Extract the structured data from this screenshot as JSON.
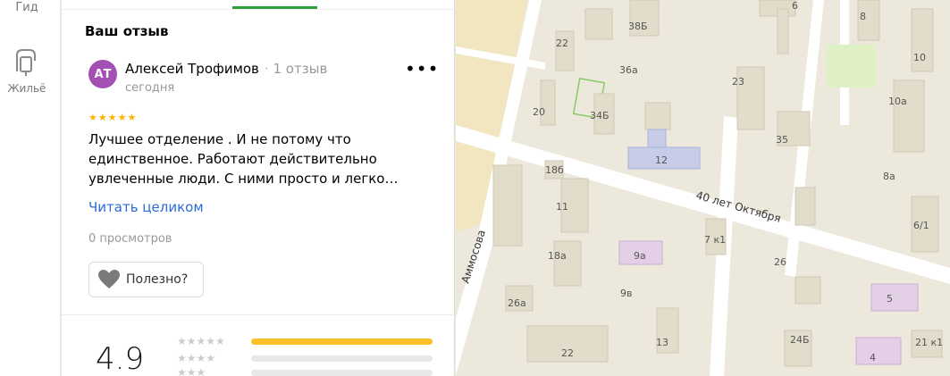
{
  "sidebar": {
    "top_label": "Гид",
    "housing_label": "Жильё"
  },
  "panel": {
    "section_title": "Ваш отзыв",
    "review": {
      "avatar_initials": "АТ",
      "author": "Алексей Трофимов",
      "review_count": "1 отзыв",
      "date": "сегодня",
      "stars": "★★★★★",
      "text": "Лучшее отделение . И не потому что единственное. Работают действительно увлеченные люди. С ними просто и легко…",
      "read_more": "Читать целиком",
      "views": "0 просмотров",
      "useful_label": "Полезно?"
    },
    "rating": {
      "value": "4.9",
      "distribution": [
        {
          "stars": "★★★★★",
          "fraction": 1.0
        },
        {
          "stars": "★★★★",
          "fraction": 0.0
        },
        {
          "stars": "★★★",
          "fraction": 0.0
        }
      ]
    }
  },
  "map": {
    "streets": [
      "40 лет Октября",
      "Аммосова"
    ],
    "house_numbers": [
      "22",
      "38Б",
      "6",
      "8",
      "10",
      "36а",
      "23",
      "20",
      "34Б",
      "10а",
      "35",
      "12",
      "18б",
      "8а",
      "11",
      "7 к1",
      "6/1",
      "9а",
      "18а",
      "26",
      "9в",
      "5",
      "26а",
      "13",
      "24Б",
      "21 к1",
      "4",
      "22"
    ]
  },
  "colors": {
    "accent_green": "#2f9e3b",
    "link_blue": "#2a6ad9",
    "star_yellow": "#ffb300",
    "avatar_purple": "#a34fb4"
  }
}
